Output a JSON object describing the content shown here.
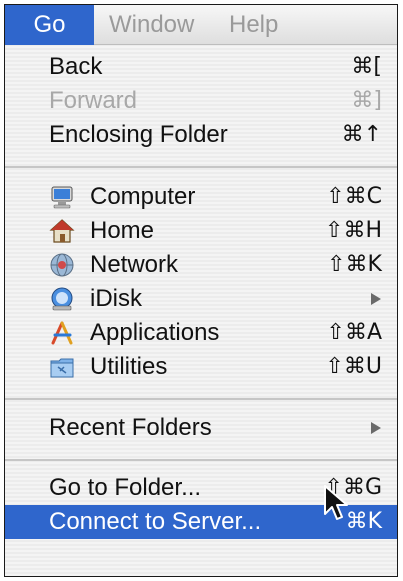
{
  "menubar": {
    "go": "Go",
    "window": "Window",
    "help": "Help"
  },
  "menu": {
    "back": {
      "label": "Back",
      "shortcut": "⌘["
    },
    "forward": {
      "label": "Forward",
      "shortcut": "⌘]",
      "enabled": false
    },
    "enclosing": {
      "label": "Enclosing Folder",
      "shortcut": "⌘↑"
    },
    "computer": {
      "label": "Computer",
      "shortcut": "⇧⌘C",
      "icon": "computer-icon"
    },
    "home": {
      "label": "Home",
      "shortcut": "⇧⌘H",
      "icon": "home-icon"
    },
    "network": {
      "label": "Network",
      "shortcut": "⇧⌘K",
      "icon": "network-icon"
    },
    "idisk": {
      "label": "iDisk",
      "submenu": true,
      "icon": "idisk-icon"
    },
    "applications": {
      "label": "Applications",
      "shortcut": "⇧⌘A",
      "icon": "applications-icon"
    },
    "utilities": {
      "label": "Utilities",
      "shortcut": "⇧⌘U",
      "icon": "utilities-folder-icon"
    },
    "recent": {
      "label": "Recent Folders",
      "submenu": true
    },
    "goto": {
      "label": "Go to Folder...",
      "shortcut": "⇧⌘G"
    },
    "connect": {
      "label": "Connect to Server...",
      "shortcut": "⌘K",
      "selected": true
    }
  },
  "colors": {
    "highlight": "#2f66cc",
    "disabled_text": "#a8a8a8"
  }
}
